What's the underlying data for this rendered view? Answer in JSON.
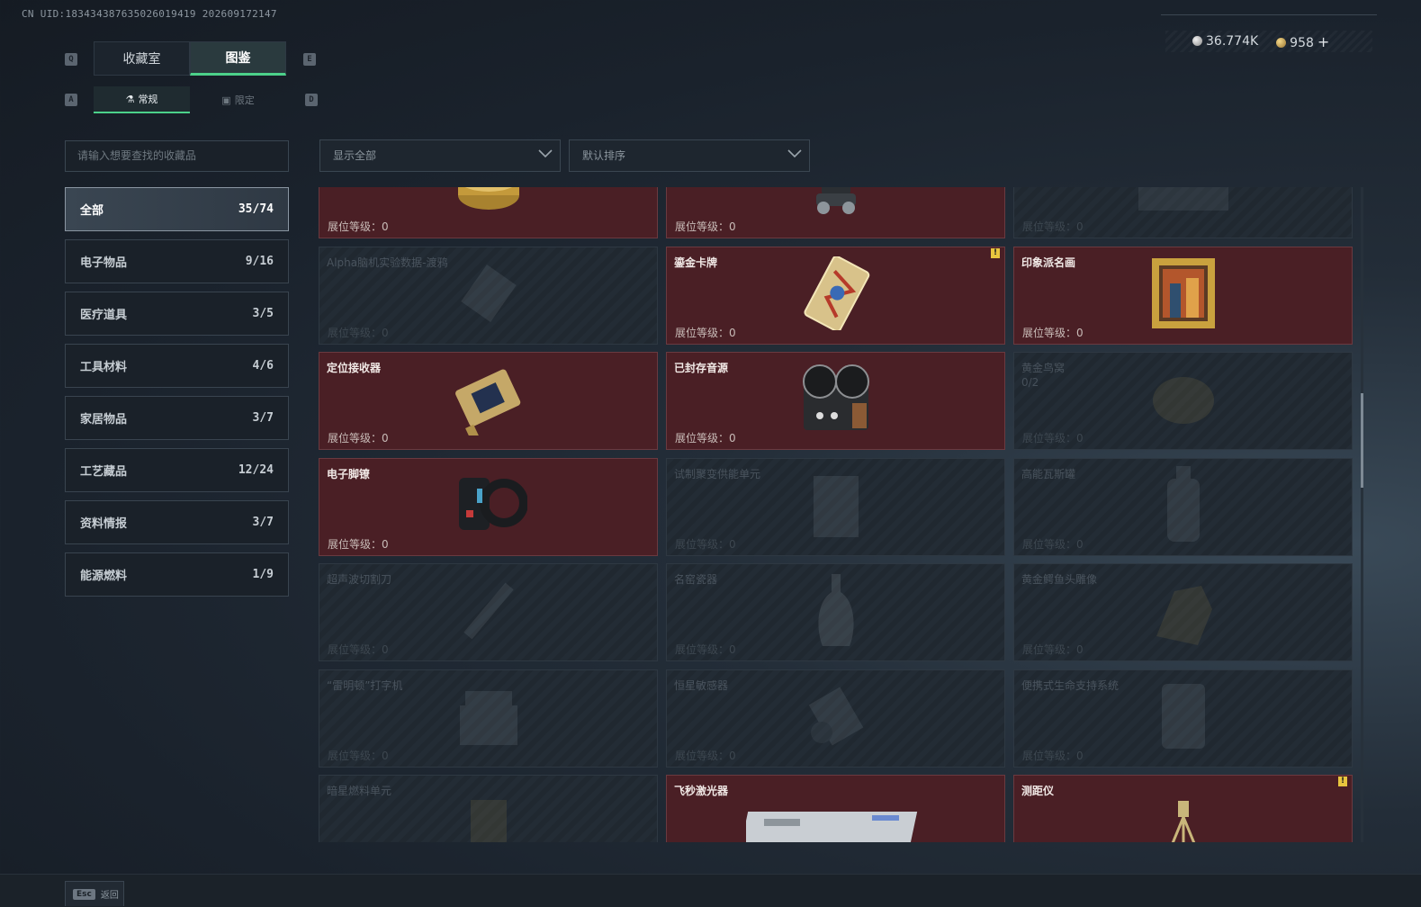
{
  "header": {
    "uid": "CN UID:18343438763502601941​9 202609172147",
    "currency_silver": "36.774K",
    "currency_gold": "958",
    "plus": "+"
  },
  "keys": {
    "tab_prev": "Q",
    "tab_next": "E",
    "sub_prev": "A",
    "sub_next": "D"
  },
  "tabs": [
    {
      "label": "收藏室",
      "active": false
    },
    {
      "label": "图鉴",
      "active": true
    }
  ],
  "subtabs": [
    {
      "label": "常规",
      "icon": "flask-icon",
      "active": true
    },
    {
      "label": "限定",
      "icon": "box-icon",
      "active": false
    }
  ],
  "search": {
    "placeholder": "请输入想要查找的收藏品"
  },
  "filters": {
    "show": "显示全部",
    "sort": "默认排序"
  },
  "categories": [
    {
      "label": "全部",
      "count": "35/74",
      "active": true
    },
    {
      "label": "电子物品",
      "count": "9/16"
    },
    {
      "label": "医疗道具",
      "count": "3/5"
    },
    {
      "label": "工具材料",
      "count": "4/6"
    },
    {
      "label": "家居物品",
      "count": "3/7"
    },
    {
      "label": "工艺藏品",
      "count": "12/24"
    },
    {
      "label": "资料情报",
      "count": "3/7"
    },
    {
      "label": "能源燃料",
      "count": "1/9"
    }
  ],
  "level_label": "展位等级：0",
  "items": [
    {
      "name": "",
      "owned": true,
      "art": "caviar-icon"
    },
    {
      "name": "",
      "owned": true,
      "art": "robot-icon"
    },
    {
      "name": "",
      "owned": false,
      "art": "crate-icon"
    },
    {
      "name": "Alpha脑机实验数据-渡鸦",
      "owned": false,
      "art": "drive-icon"
    },
    {
      "name": "鎏金卡牌",
      "owned": true,
      "art": "card-icon",
      "badge": "!"
    },
    {
      "name": "印象派名画",
      "owned": true,
      "art": "painting-icon"
    },
    {
      "name": "定位接收器",
      "owned": true,
      "art": "receiver-icon"
    },
    {
      "name": "已封存音源",
      "owned": true,
      "art": "reel-icon"
    },
    {
      "name": "黄金鸟窝",
      "owned": false,
      "art": "nest-icon",
      "sub": "0/2"
    },
    {
      "name": "电子脚镣",
      "owned": true,
      "art": "anklet-icon"
    },
    {
      "name": "试制聚变供能单元",
      "owned": false,
      "art": "fusion-icon"
    },
    {
      "name": "高能瓦斯罐",
      "owned": false,
      "art": "canister-icon"
    },
    {
      "name": "超声波切割刀",
      "owned": false,
      "art": "knife-icon"
    },
    {
      "name": "名窑瓷器",
      "owned": false,
      "art": "vase-icon"
    },
    {
      "name": "黄金鳄鱼头雕像",
      "owned": false,
      "art": "statue-icon"
    },
    {
      "name": "“雷明顿”打字机",
      "owned": false,
      "art": "typewriter-icon"
    },
    {
      "name": "恒星敏感器",
      "owned": false,
      "art": "sensor-icon"
    },
    {
      "name": "便携式生命支持系统",
      "owned": false,
      "art": "lifesupport-icon"
    },
    {
      "name": "暗星燃料单元",
      "owned": false,
      "art": "fuel-icon"
    },
    {
      "name": "飞秒激光器",
      "owned": true,
      "art": "laser-icon"
    },
    {
      "name": "测距仪",
      "owned": true,
      "art": "rangefinder-icon",
      "badge": "!"
    }
  ],
  "footer": {
    "esc_key": "Esc",
    "back_label": "返回"
  }
}
